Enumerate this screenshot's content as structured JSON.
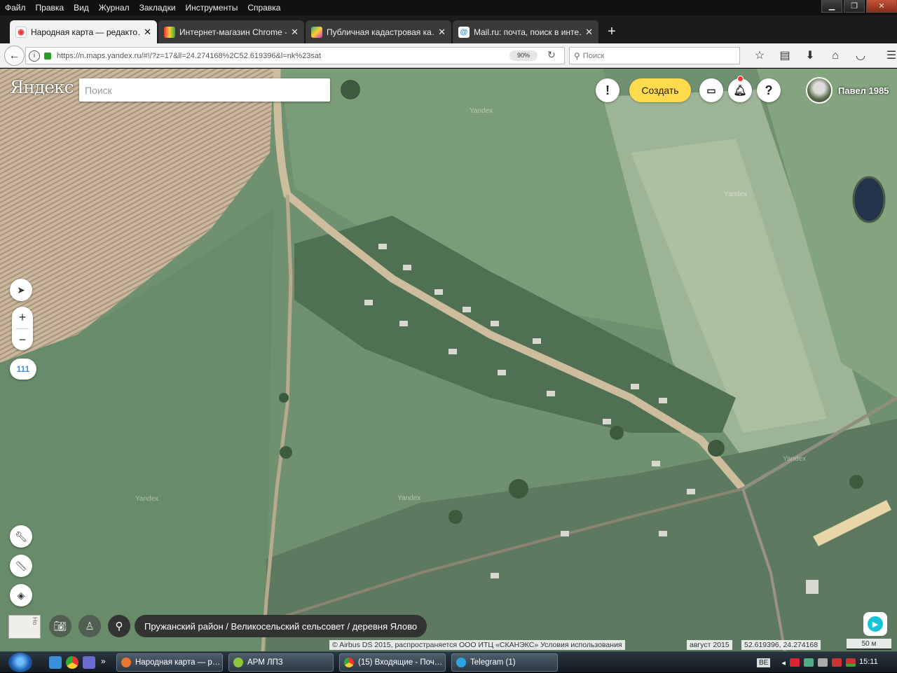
{
  "menu": [
    "Файл",
    "Правка",
    "Вид",
    "Журнал",
    "Закладки",
    "Инструменты",
    "Справка"
  ],
  "window_controls": {
    "minimize": "▁",
    "restore": "❐",
    "close": "✕"
  },
  "tabs": [
    {
      "label": "Народная карта — редакто…",
      "active": true,
      "icon": "map-pin-icon"
    },
    {
      "label": "Интернет-магазин Chrome - …",
      "active": false,
      "icon": "chrome-store-icon"
    },
    {
      "label": "Публичная кадастровая ка…",
      "active": false,
      "icon": "cadastre-icon"
    },
    {
      "label": "Mail.ru: почта, поиск в инте…",
      "active": false,
      "icon": "mailru-icon"
    }
  ],
  "new_tab": "+",
  "address": {
    "url": "https://n.maps.yandex.ru/#!/?z=17&ll=24.274168%2C52.619396&l=nk%23sat",
    "zoom": "90%"
  },
  "browser_search": {
    "placeholder": "Поиск"
  },
  "map": {
    "logo": "Яндекс",
    "search_placeholder": "Поиск",
    "alert_button": "!",
    "create_button": "Создать",
    "help_button": "?",
    "user_name": "Павел 1985",
    "zoom_in": "+",
    "zoom_out": "−",
    "zoom_level_badge": "111",
    "breadcrumb": "Пружанский район / Великосельский сельсовет / деревня Ялово",
    "copyright": "© Airbus DS 2015, распространяется ООО ИТЦ «СКАНЭКС» Условия использования",
    "imagery_date": "август 2015",
    "coordinates": "52.619396, 24.274168",
    "scale": "50 м",
    "minimap_label": "Но",
    "watermark": "Yandex"
  },
  "taskbar": {
    "items": [
      {
        "label": "Народная карта — р…",
        "color": "#e8762c"
      },
      {
        "label": "АРМ ЛПЗ",
        "color": "#8cc63f"
      },
      {
        "label": "(15) Входящие - Поч…",
        "color": "#e8412c"
      },
      {
        "label": "Telegram (1)",
        "color": "#2ca5e0"
      }
    ],
    "language": "BE",
    "clock": "15:11"
  }
}
